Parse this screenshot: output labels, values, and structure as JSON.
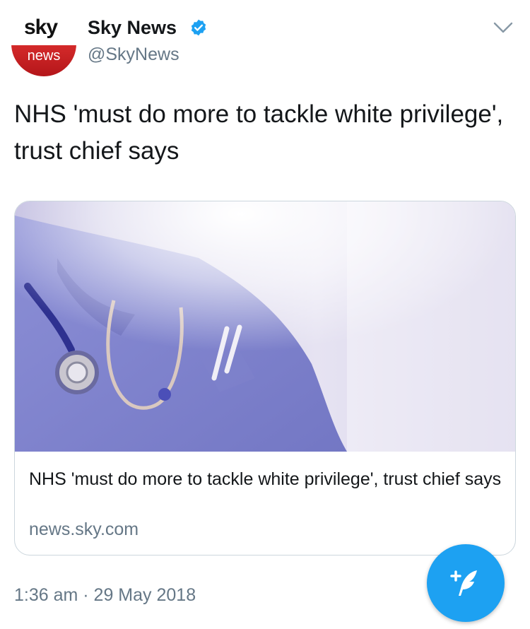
{
  "account": {
    "avatar_top": "sky",
    "avatar_bottom": "news",
    "name": "Sky News",
    "handle": "@SkyNews",
    "verified_icon": "verified-badge-icon"
  },
  "tweet": {
    "text": "NHS 'must do more to tackle white privilege', trust chief says",
    "timestamp": "1:36 am · 29 May 2018"
  },
  "card": {
    "image_icon": "nurse-stethoscope-photo",
    "title": "NHS 'must do more to tackle white privilege', trust chief says",
    "domain": "news.sky.com"
  },
  "icons": {
    "menu": "chevron-down-icon",
    "compose": "compose-tweet-icon"
  },
  "colors": {
    "accent": "#1da1f2",
    "secondary_text": "#657786",
    "brand_red": "#c8191e"
  }
}
